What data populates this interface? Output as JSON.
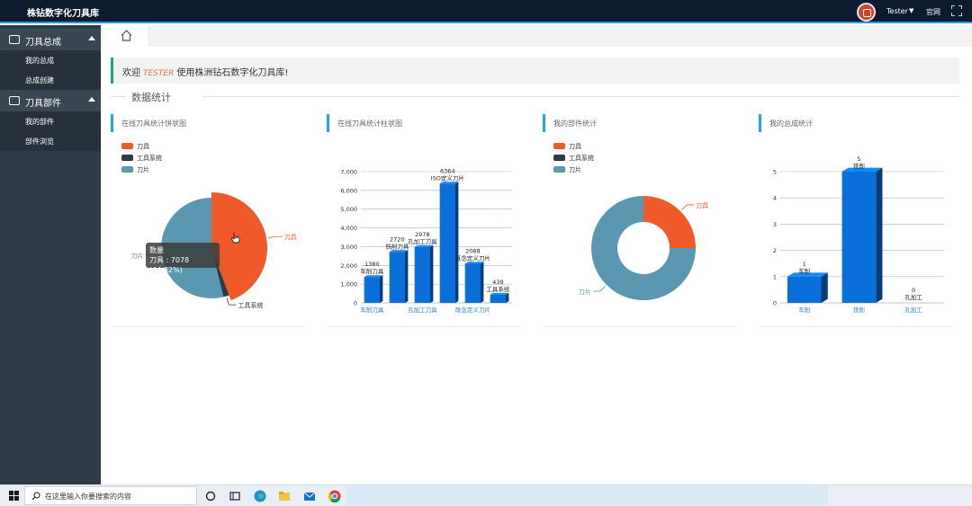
{
  "app": {
    "title": "株钻数字化刀具库"
  },
  "header": {
    "user": "Tester",
    "official": "官网"
  },
  "sidebar": {
    "groups": [
      {
        "label": "刀具总成",
        "items": [
          "我的总成",
          "总成创建"
        ]
      },
      {
        "label": "刀具部件",
        "items": [
          "我的部件",
          "部件浏览"
        ]
      }
    ]
  },
  "welcome": {
    "prefix": "欢迎",
    "user": "TESTER",
    "suffix": "使用株洲钻石数字化刀具库!"
  },
  "section": {
    "title": "数据统计"
  },
  "cards": [
    {
      "title": "在线刀具统计饼状图"
    },
    {
      "title": "在线刀具统计柱状图"
    },
    {
      "title": "我的部件统计"
    },
    {
      "title": "我的总成统计"
    }
  ],
  "tooltip": {
    "title": "数量",
    "value": "刀具 : 7078 (44.32%)"
  },
  "taskbar": {
    "search_placeholder": "在这里输入你要搜索的内容"
  },
  "colors": {
    "red": "#f05a2a",
    "navy": "#2a3b4c",
    "teal": "#5b97b0",
    "blue": "#0a6fd8",
    "accent": "#1ea7e0"
  },
  "chart_data": [
    {
      "type": "pie",
      "title": "在线刀具统计饼状图",
      "legend": [
        "刀具",
        "工具系统",
        "刀片"
      ],
      "legend_position": "top-left",
      "slices": [
        {
          "name": "刀具",
          "value": 7078,
          "color": "#f05a2a"
        },
        {
          "name": "工具系统",
          "value": 300,
          "color": "#2a3b4c"
        },
        {
          "name": "刀片",
          "value": 8592,
          "color": "#5b97b0"
        }
      ],
      "highlighted": "刀具"
    },
    {
      "type": "bar",
      "title": "在线刀具统计柱状图",
      "categories": [
        "车削刀具",
        "铣削刀具",
        "孔加工刀具",
        "ISO定义刀片",
        "既念定义刀片",
        "工具系统"
      ],
      "x_tick_labels": [
        "车削刀具",
        "孔加工刀具",
        "既念定义刀片"
      ],
      "values": [
        1380,
        2720,
        2978,
        6364,
        2088,
        439
      ],
      "ylim": [
        0,
        7000
      ],
      "yticks": [
        "0",
        "1,000",
        "2,000",
        "3,000",
        "4,000",
        "5,000",
        "6,000",
        "7,000"
      ],
      "grid": true
    },
    {
      "type": "pie",
      "title": "我的部件统计",
      "legend": [
        "刀具",
        "工具系统",
        "刀片"
      ],
      "legend_position": "top-left",
      "slices": [
        {
          "name": "刀具",
          "value": 1,
          "color": "#f05a2a"
        },
        {
          "name": "工具系统",
          "value": 0,
          "color": "#2a3b4c"
        },
        {
          "name": "刀片",
          "value": 3,
          "color": "#5b97b0"
        }
      ],
      "donut": true
    },
    {
      "type": "bar",
      "title": "我的总成统计",
      "categories": [
        "车削",
        "铣削",
        "孔加工"
      ],
      "values": [
        1,
        5,
        0
      ],
      "ylim": [
        0,
        5
      ],
      "yticks": [
        "0",
        "1",
        "2",
        "3",
        "4",
        "5"
      ],
      "grid": true
    }
  ]
}
